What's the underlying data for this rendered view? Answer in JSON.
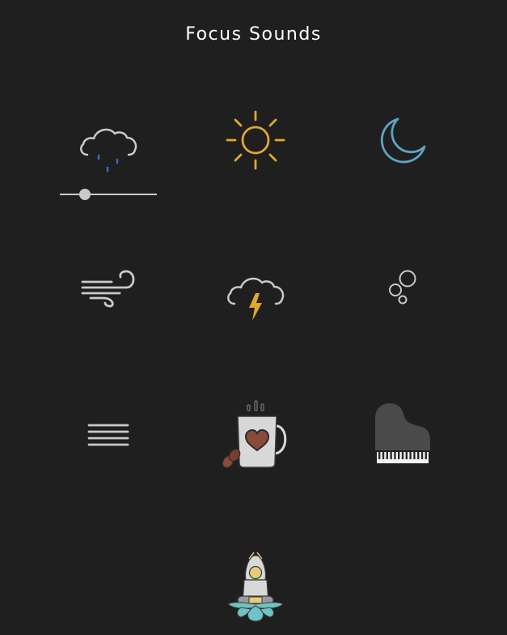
{
  "app": {
    "title": "Focus Sounds"
  },
  "sounds": [
    {
      "id": "rain",
      "icon": "rain-cloud-icon",
      "active": true,
      "volume": 0.26
    },
    {
      "id": "summer-day",
      "icon": "sun-icon",
      "active": false
    },
    {
      "id": "night",
      "icon": "moon-icon",
      "active": false
    },
    {
      "id": "wind",
      "icon": "wind-icon",
      "active": false
    },
    {
      "id": "thunder",
      "icon": "thunder-cloud-icon",
      "active": false
    },
    {
      "id": "bubbles",
      "icon": "bubbles-icon",
      "active": false
    },
    {
      "id": "white-noise",
      "icon": "waves-lines-icon",
      "active": false
    },
    {
      "id": "coffee-shop",
      "icon": "coffee-mug-icon",
      "active": false
    },
    {
      "id": "piano",
      "icon": "grand-piano-icon",
      "active": false
    },
    {
      "id": "meditation",
      "icon": "meditation-lotus-icon",
      "active": false
    }
  ],
  "colors": {
    "background": "#1f1f1f",
    "icon_gray": "#c9c9c9",
    "sun": "#e0a82e",
    "moon": "#5fa3c4",
    "rain_drops": "#2f6fd6",
    "lightning": "#e0a82e",
    "coffee_heart": "#8a4a3a",
    "piano": "#4a4a4a",
    "lotus": "#6fc3c4"
  }
}
